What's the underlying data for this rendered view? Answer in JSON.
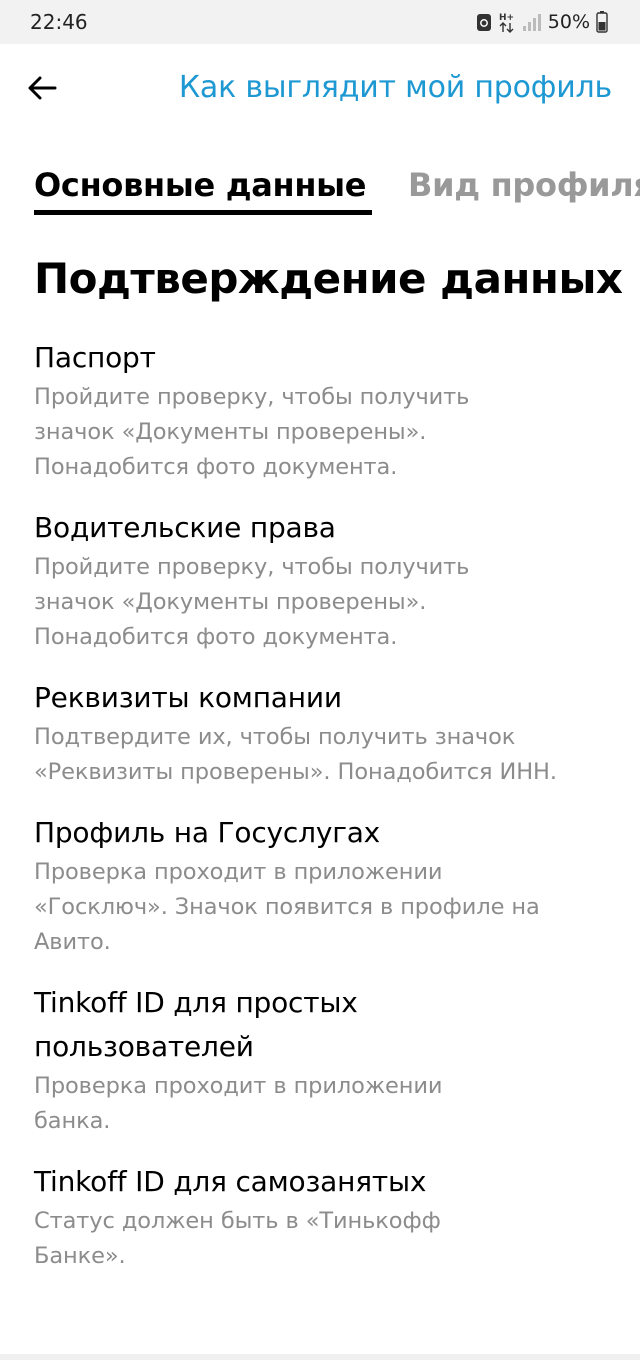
{
  "status_bar": {
    "time": "22:46",
    "battery": "50%",
    "icons": [
      "sync-icon",
      "network-hplus-icon",
      "signal-icon",
      "battery-icon"
    ]
  },
  "header": {
    "back_icon": "arrow-left-icon",
    "link": "Как выглядит мой профиль"
  },
  "tabs": [
    {
      "label": "Основные данные",
      "active": true
    },
    {
      "label": "Вид профиля",
      "active": false
    }
  ],
  "section": {
    "title": "Подтверждение данных",
    "items": [
      {
        "title": "Паспорт",
        "description": "Пройдите проверку, чтобы получить значок «Документы проверены». Понадобится фото документа."
      },
      {
        "title": "Водительские права",
        "description": "Пройдите проверку, чтобы получить значок «Документы проверены». Понадобится фото документа."
      },
      {
        "title": "Реквизиты компании",
        "description": "Подтвердите их, чтобы получить значок «Реквизиты проверены». Понадобится ИНН."
      },
      {
        "title": "Профиль на Госуслугах",
        "description": "Проверка проходит в приложении «Госключ». Значок появится в профиле на Авито."
      },
      {
        "title": "Tinkoff ID для простых пользователей",
        "description": "Проверка проходит в приложении банка."
      },
      {
        "title": "Tinkoff ID для самозанятых",
        "description": "Статус должен быть в «Тинькофф Банке»."
      }
    ]
  },
  "colors": {
    "accent": "#1e98d2",
    "muted_text": "#8c8c8c",
    "inactive_tab": "#999999"
  }
}
